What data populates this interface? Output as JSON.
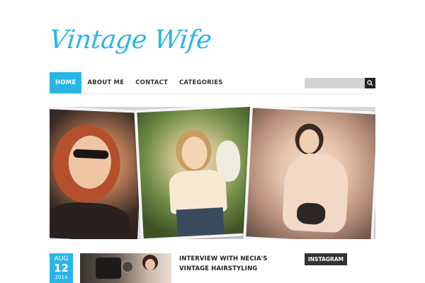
{
  "site": {
    "title": "Vintage Wife"
  },
  "nav": {
    "items": [
      {
        "label": "HOME",
        "active": true
      },
      {
        "label": "ABOUT ME",
        "active": false
      },
      {
        "label": "CONTACT",
        "active": false
      },
      {
        "label": "CATEGORIES",
        "active": false
      }
    ]
  },
  "search": {
    "placeholder": "",
    "icon": "search-icon"
  },
  "slider": {
    "photos": [
      {
        "name": "photo-woman-sunglasses"
      },
      {
        "name": "photo-woman-with-owl"
      },
      {
        "name": "photo-woman-seated"
      }
    ]
  },
  "post": {
    "date": {
      "month": "AUG",
      "day": "12",
      "year": "2014"
    },
    "title": "INTERVIEW WITH NECIA'S VINTAGE HAIRSTYLING"
  },
  "sidebar": {
    "widget_title": "INSTAGRAM"
  },
  "colors": {
    "accent": "#29b6e6",
    "dark": "#333333"
  }
}
